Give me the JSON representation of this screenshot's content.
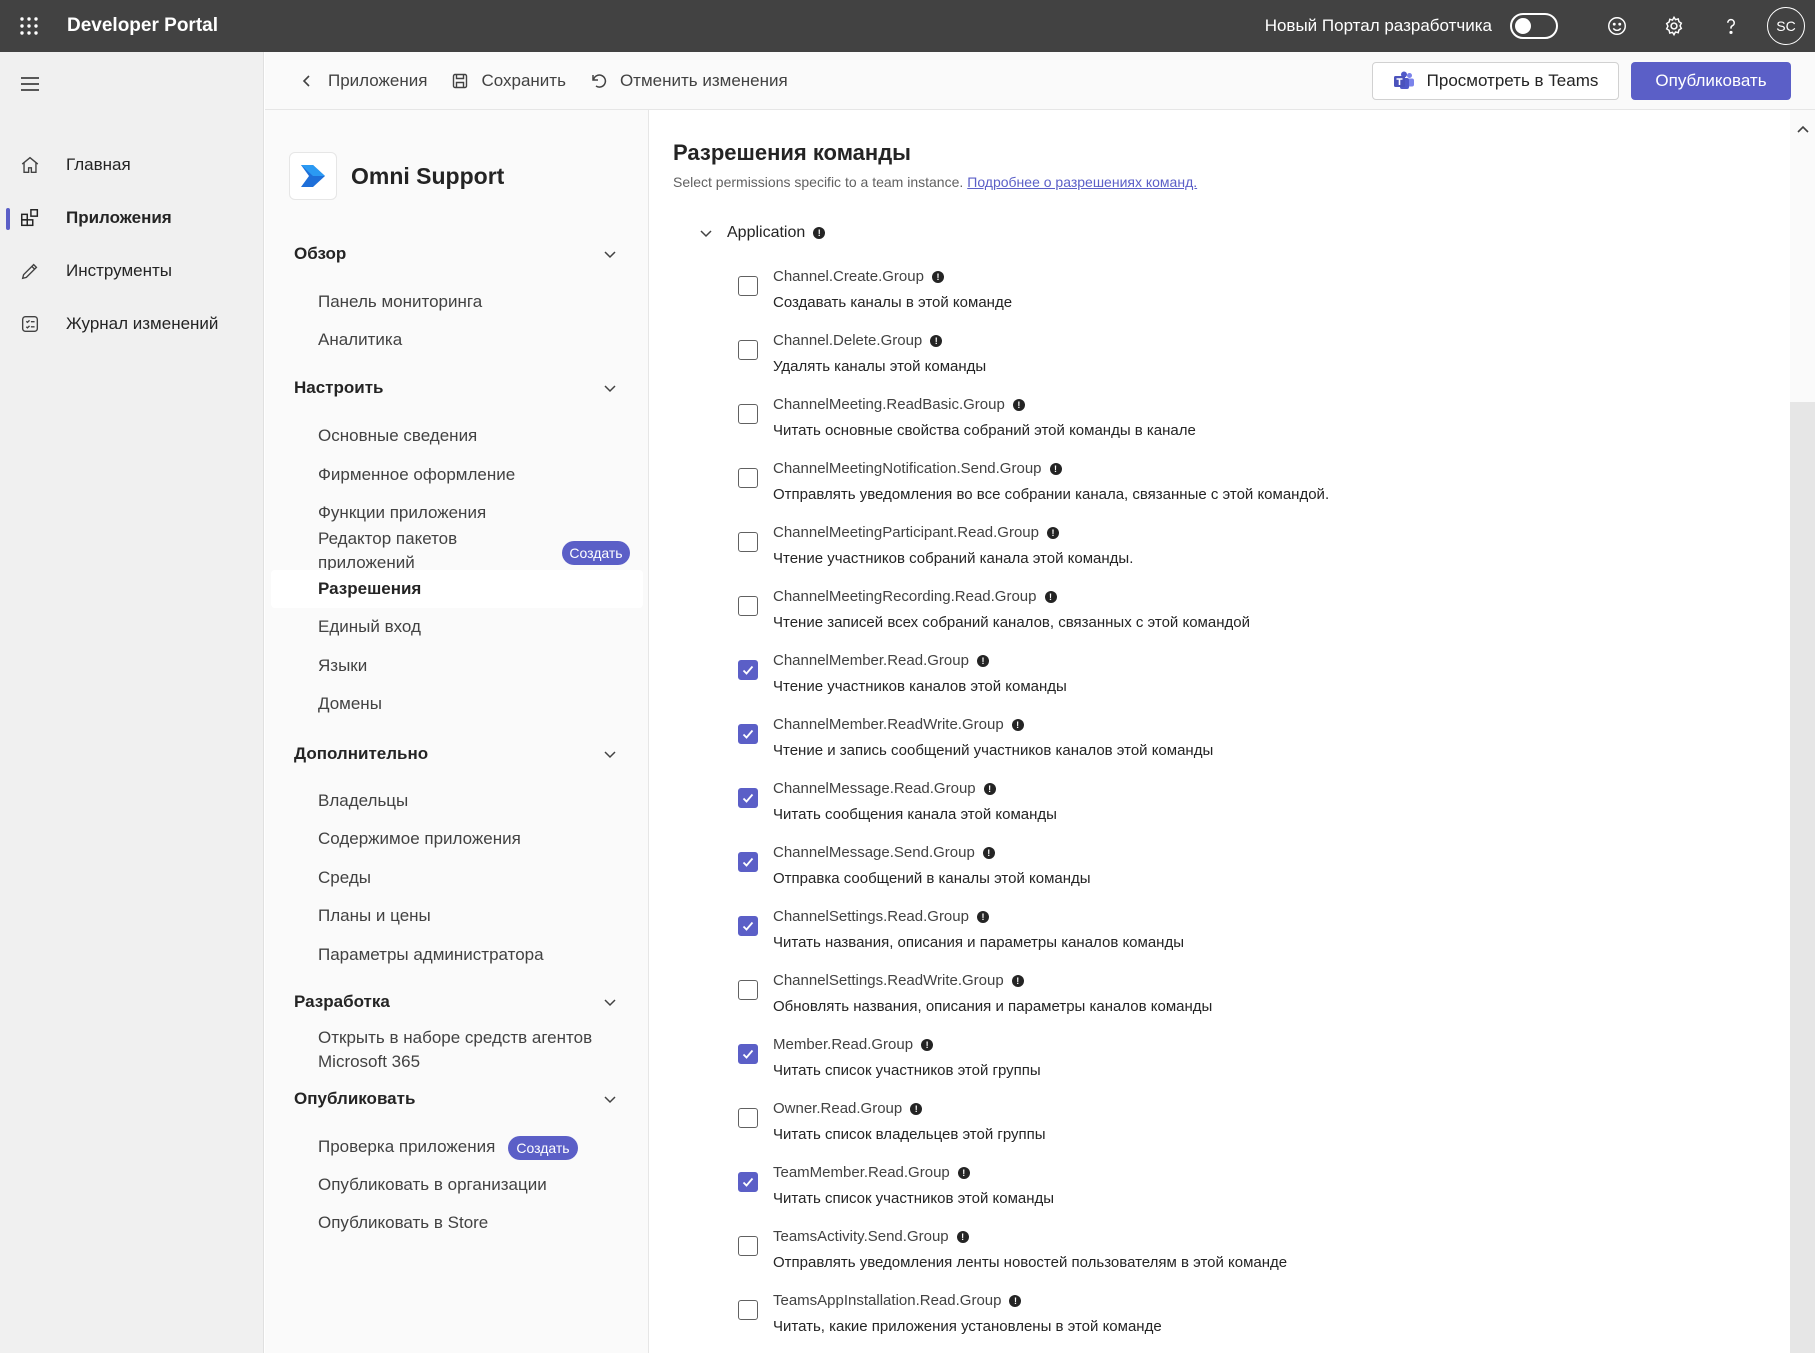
{
  "topbar": {
    "title": "Developer Portal",
    "toggle_label": "Новый Портал разработчика",
    "toggle_on": false,
    "avatar_initials": "SC"
  },
  "leftnav": {
    "items": [
      {
        "label": "Главная",
        "icon": "home-icon"
      },
      {
        "label": "Приложения",
        "icon": "apps-icon",
        "active": true
      },
      {
        "label": "Инструменты",
        "icon": "pencil-icon"
      },
      {
        "label": "Журнал изменений",
        "icon": "changelog-icon"
      }
    ]
  },
  "cmdbar": {
    "back_label": "Приложения",
    "save_label": "Сохранить",
    "undo_label": "Отменить изменения",
    "teams_label": "Просмотреть в Teams",
    "publish_label": "Опубликовать"
  },
  "appnav": {
    "app_name": "Omni Support",
    "sections": {
      "overview": {
        "title": "Обзор",
        "items": [
          "Панель мониторинга",
          "Аналитика"
        ]
      },
      "configure": {
        "title": "Настроить",
        "items": [
          "Основные сведения",
          "Фирменное оформление",
          "Функции приложения",
          "Редактор пакетов приложений",
          "Разрешения",
          "Единый вход",
          "Языки",
          "Домены"
        ],
        "badge": "Создать",
        "selected": "Разрешения"
      },
      "advanced": {
        "title": "Дополнительно",
        "items": [
          "Владельцы",
          "Содержимое приложения",
          "Среды",
          "Планы и цены",
          "Параметры администратора"
        ]
      },
      "develop": {
        "title": "Разработка",
        "items": [
          "Открыть в наборе средств агентов Microsoft 365"
        ]
      },
      "publish": {
        "title": "Опубликовать",
        "items": [
          "Проверка приложения",
          "Опубликовать в организации",
          "Опубликовать в Store"
        ],
        "badge": "Создать"
      }
    }
  },
  "main": {
    "title": "Разрешения команды",
    "description": "Select permissions specific to a team instance.",
    "link": "Подробнее о разрешениях команд.",
    "group_label": "Application",
    "permissions": [
      {
        "name": "Channel.Create.Group",
        "desc": "Создавать каналы в этой команде",
        "checked": false
      },
      {
        "name": "Channel.Delete.Group",
        "desc": "Удалять каналы этой команды",
        "checked": false
      },
      {
        "name": "ChannelMeeting.ReadBasic.Group",
        "desc": "Читать основные свойства собраний этой команды в канале",
        "checked": false
      },
      {
        "name": "ChannelMeetingNotification.Send.Group",
        "desc": "Отправлять уведомления во все собрании канала, связанные с этой командой.",
        "checked": false
      },
      {
        "name": "ChannelMeetingParticipant.Read.Group",
        "desc": "Чтение участников собраний канала этой команды.",
        "checked": false
      },
      {
        "name": "ChannelMeetingRecording.Read.Group",
        "desc": "Чтение записей всех собраний каналов, связанных с этой командой",
        "checked": false
      },
      {
        "name": "ChannelMember.Read.Group",
        "desc": "Чтение участников каналов этой команды",
        "checked": true
      },
      {
        "name": "ChannelMember.ReadWrite.Group",
        "desc": "Чтение и запись сообщений участников каналов этой команды",
        "checked": true
      },
      {
        "name": "ChannelMessage.Read.Group",
        "desc": "Читать сообщения канала этой команды",
        "checked": true
      },
      {
        "name": "ChannelMessage.Send.Group",
        "desc": "Отправка сообщений в каналы этой команды",
        "checked": true
      },
      {
        "name": "ChannelSettings.Read.Group",
        "desc": "Читать названия, описания и параметры каналов команды",
        "checked": true
      },
      {
        "name": "ChannelSettings.ReadWrite.Group",
        "desc": "Обновлять названия, описания и параметры каналов команды",
        "checked": false
      },
      {
        "name": "Member.Read.Group",
        "desc": "Читать список участников этой группы",
        "checked": true
      },
      {
        "name": "Owner.Read.Group",
        "desc": "Читать список владельцев этой группы",
        "checked": false
      },
      {
        "name": "TeamMember.Read.Group",
        "desc": "Читать список участников этой команды",
        "checked": true
      },
      {
        "name": "TeamsActivity.Send.Group",
        "desc": "Отправлять уведомления ленты новостей пользователям в этой команде",
        "checked": false
      },
      {
        "name": "TeamsAppInstallation.Read.Group",
        "desc": "Читать, какие приложения установлены в этой команде",
        "checked": false
      }
    ]
  },
  "colors": {
    "accent": "#5b5fc7",
    "topbar": "#424242"
  }
}
